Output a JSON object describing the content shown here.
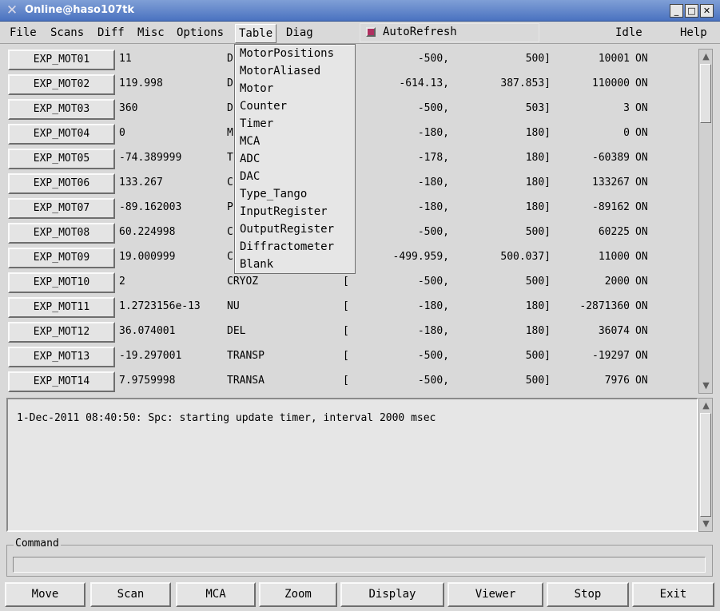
{
  "window": {
    "title": "Online@haso107tk",
    "app_icon": "x-cross-icon",
    "controls": {
      "minimize": "_",
      "maximize": "□",
      "close": "✕"
    }
  },
  "menubar": {
    "items": [
      "File",
      "Scans",
      "Diff",
      "Misc",
      "Options",
      "Table",
      "Diag"
    ],
    "active": "Table",
    "autorefresh_label": "AutoRefresh",
    "autorefresh_checked": true,
    "status": "Idle",
    "help": "Help",
    "colors": {
      "checkbox": "#b03060",
      "titlebar": "#4a72c0"
    }
  },
  "table_menu": {
    "items": [
      "MotorPositions",
      "MotorAliased",
      "Motor",
      "Counter",
      "Timer",
      "MCA",
      "ADC",
      "DAC",
      "Type_Tango",
      "InputRegister",
      "OutputRegister",
      "Diffractometer",
      "Blank"
    ]
  },
  "motors": [
    {
      "name": "EXP_MOT01",
      "position": "11",
      "alias": "D",
      "bracket": "",
      "min": "-500,",
      "max": "500]",
      "steps": "10001",
      "state": "ON"
    },
    {
      "name": "EXP_MOT02",
      "position": "119.998",
      "alias": "D",
      "bracket": "",
      "min": "-614.13,",
      "max": "387.853]",
      "steps": "110000",
      "state": "ON"
    },
    {
      "name": "EXP_MOT03",
      "position": "360",
      "alias": "D",
      "bracket": "",
      "min": "-500,",
      "max": "503]",
      "steps": "3",
      "state": "ON"
    },
    {
      "name": "EXP_MOT04",
      "position": "0",
      "alias": "M",
      "bracket": "",
      "min": "-180,",
      "max": "180]",
      "steps": "0",
      "state": "ON"
    },
    {
      "name": "EXP_MOT05",
      "position": "-74.389999",
      "alias": "T",
      "bracket": "",
      "min": "-178,",
      "max": "180]",
      "steps": "-60389",
      "state": "ON"
    },
    {
      "name": "EXP_MOT06",
      "position": "133.267",
      "alias": "C",
      "bracket": "",
      "min": "-180,",
      "max": "180]",
      "steps": "133267",
      "state": "ON"
    },
    {
      "name": "EXP_MOT07",
      "position": "-89.162003",
      "alias": "P",
      "bracket": "",
      "min": "-180,",
      "max": "180]",
      "steps": "-89162",
      "state": "ON"
    },
    {
      "name": "EXP_MOT08",
      "position": "60.224998",
      "alias": "C",
      "bracket": "",
      "min": "-500,",
      "max": "500]",
      "steps": "60225",
      "state": "ON"
    },
    {
      "name": "EXP_MOT09",
      "position": "19.000999",
      "alias": "C",
      "bracket": "",
      "min": "-499.959,",
      "max": "500.037]",
      "steps": "11000",
      "state": "ON"
    },
    {
      "name": "EXP_MOT10",
      "position": "2",
      "alias": "CRYOZ",
      "bracket": "[",
      "min": "-500,",
      "max": "500]",
      "steps": "2000",
      "state": "ON"
    },
    {
      "name": "EXP_MOT11",
      "position": "1.2723156e-13",
      "alias": "NU",
      "bracket": "[",
      "min": "-180,",
      "max": "180]",
      "steps": "-2871360",
      "state": "ON"
    },
    {
      "name": "EXP_MOT12",
      "position": "36.074001",
      "alias": "DEL",
      "bracket": "[",
      "min": "-180,",
      "max": "180]",
      "steps": "36074",
      "state": "ON"
    },
    {
      "name": "EXP_MOT13",
      "position": "-19.297001",
      "alias": "TRANSP",
      "bracket": "[",
      "min": "-500,",
      "max": "500]",
      "steps": "-19297",
      "state": "ON"
    },
    {
      "name": "EXP_MOT14",
      "position": "7.9759998",
      "alias": "TRANSA",
      "bracket": "[",
      "min": "-500,",
      "max": "500]",
      "steps": "7976",
      "state": "ON"
    }
  ],
  "log": {
    "line": "1-Dec-2011 08:40:50: Spc: starting update timer, interval 2000 msec"
  },
  "command": {
    "label": "Command",
    "value": ""
  },
  "buttons": [
    "Move",
    "Scan",
    "MCA",
    "Zoom",
    "Display",
    "Viewer",
    "Stop",
    "Exit"
  ]
}
